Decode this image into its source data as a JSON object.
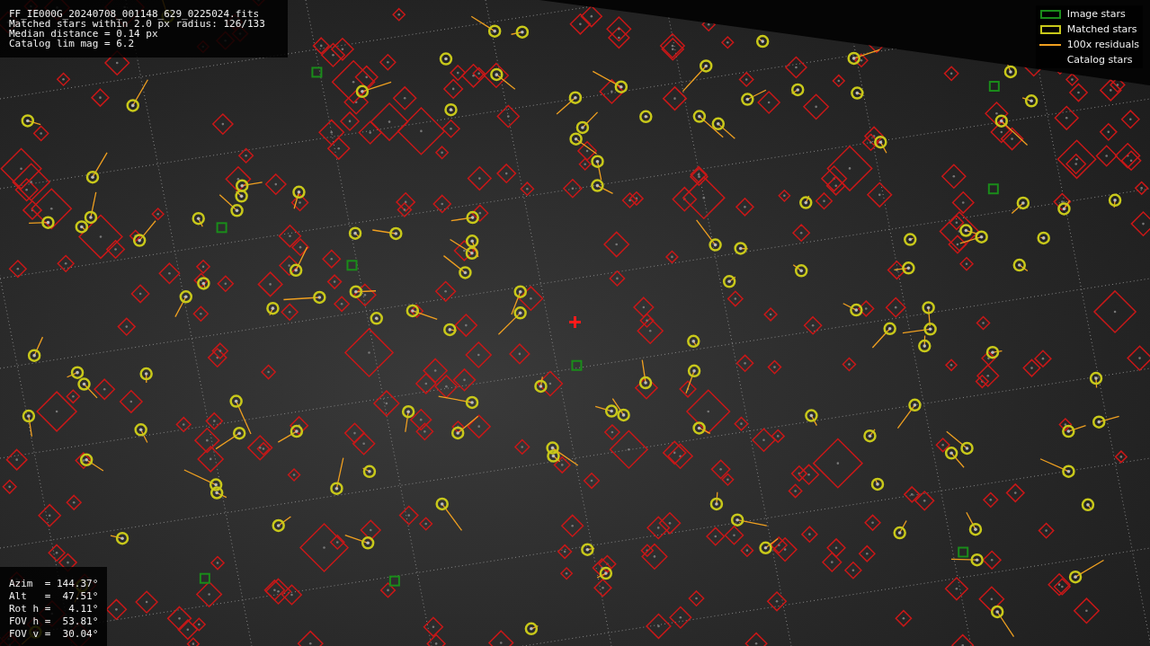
{
  "info_top": {
    "lines": [
      "FF_IE000G_20240708_001148_629_0225024.fits",
      "Matched stars within 2.0 px radius: 126/133",
      "Median distance = 0.14 px",
      "Catalog lim mag = 6.2"
    ]
  },
  "legend": {
    "items": [
      {
        "label": "Image stars",
        "kind": "box",
        "color": "#1a8c1a"
      },
      {
        "label": "Matched stars",
        "kind": "box",
        "color": "#c8c81a"
      },
      {
        "label": "100x residuals",
        "kind": "line",
        "color": "#f0a020"
      },
      {
        "label": "Catalog stars",
        "kind": "none"
      }
    ]
  },
  "info_bottom": {
    "lines": [
      "Azim  = 144.37°",
      "Alt   =  47.51°",
      "Rot h =   4.11°",
      "FOV h =  53.81°",
      "FOV v =  30.04°"
    ]
  }
}
